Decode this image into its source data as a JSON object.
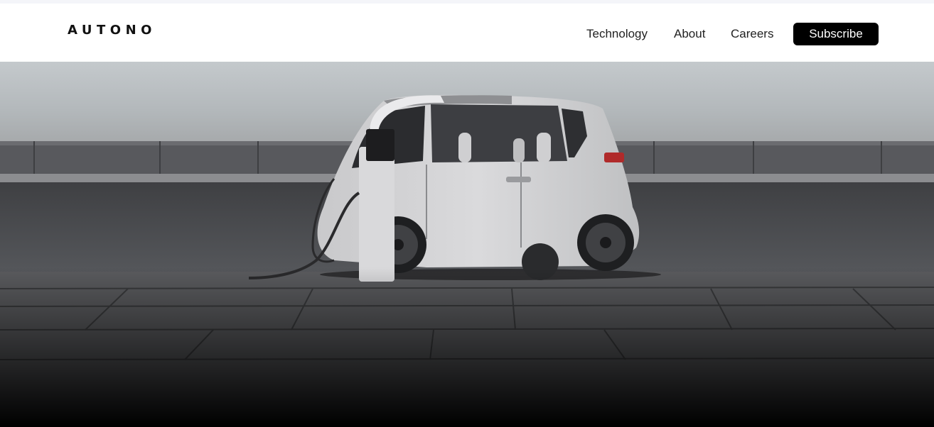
{
  "header": {
    "logo": "AUTONO",
    "nav": [
      {
        "label": "Technology"
      },
      {
        "label": "About"
      },
      {
        "label": "Careers"
      }
    ],
    "subscribe_label": "Subscribe"
  },
  "hero": {
    "image": "electric-car-charging-photo",
    "colors": {
      "sky": "#b9bec2",
      "road": "#4b4c50",
      "car_body": "#d4d4d6",
      "fade": "#000000"
    }
  }
}
